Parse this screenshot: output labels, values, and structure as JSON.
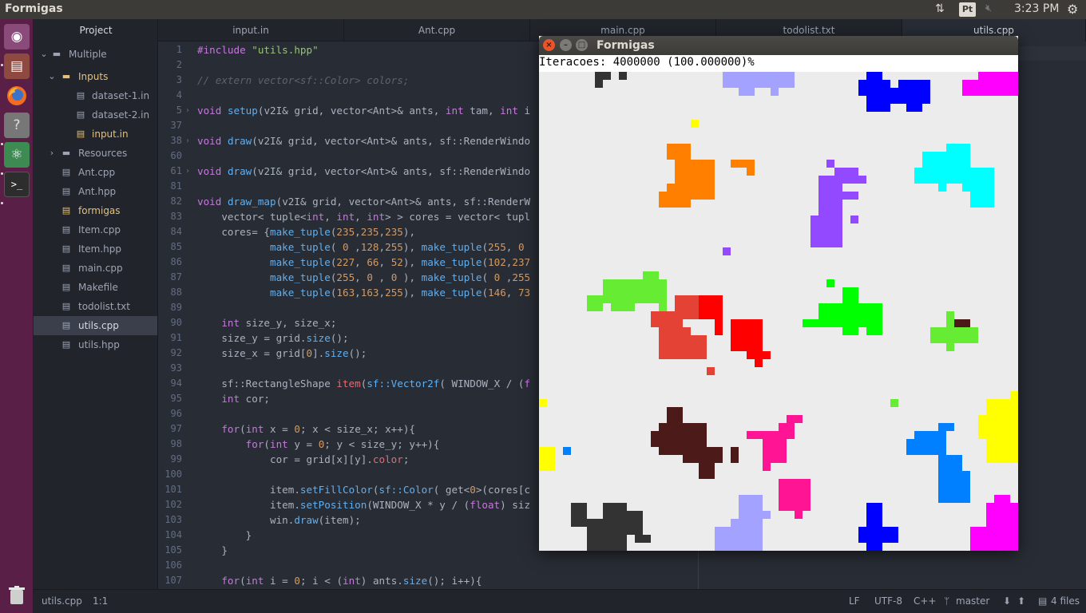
{
  "topbar": {
    "title": "Formigas",
    "keyboard_layout": "Pt",
    "clock": "3:23 PM",
    "network_icon": "network-arrows-icon",
    "volume_icon": "volume-muted-icon",
    "settings_icon": "gear-icon"
  },
  "launcher": {
    "items": [
      "ubuntu-dash",
      "files",
      "firefox",
      "help",
      "atom",
      "terminal",
      "trash"
    ]
  },
  "tree": {
    "header": "Project",
    "root": "Multiple",
    "inputs_folder": "Inputs",
    "files_inputs": [
      "dataset-1.in",
      "dataset-2.in",
      "input.in"
    ],
    "resources_folder": "Resources",
    "files": [
      "Ant.cpp",
      "Ant.hpp",
      "formigas",
      "Item.cpp",
      "Item.hpp",
      "main.cpp",
      "Makefile",
      "todolist.txt",
      "utils.cpp",
      "utils.hpp"
    ]
  },
  "tabs": [
    "input.in",
    "Ant.cpp",
    "main.cpp",
    "todolist.txt",
    "utils.cpp"
  ],
  "editor": {
    "line_numbers": [
      "1",
      "2",
      "3",
      "4",
      "5",
      "37",
      "38",
      "60",
      "61",
      "81",
      "82",
      "83",
      "84",
      "85",
      "86",
      "87",
      "88",
      "89",
      "90",
      "91",
      "92",
      "93",
      "94",
      "95",
      "96",
      "97",
      "98",
      "99",
      "100",
      "101",
      "102",
      "103",
      "104",
      "105",
      "106",
      "107"
    ],
    "fold_rows": [
      4,
      6,
      8
    ]
  },
  "status": {
    "file": "utils.cpp",
    "position": "1:1",
    "line_ending": "LF",
    "encoding": "UTF-8",
    "grammar": "C++",
    "branch": "master",
    "files_changed": "4 files"
  },
  "sfml": {
    "title": "Formigas",
    "iterations": "Iteracoes: 4000000 (100.000000)%"
  }
}
